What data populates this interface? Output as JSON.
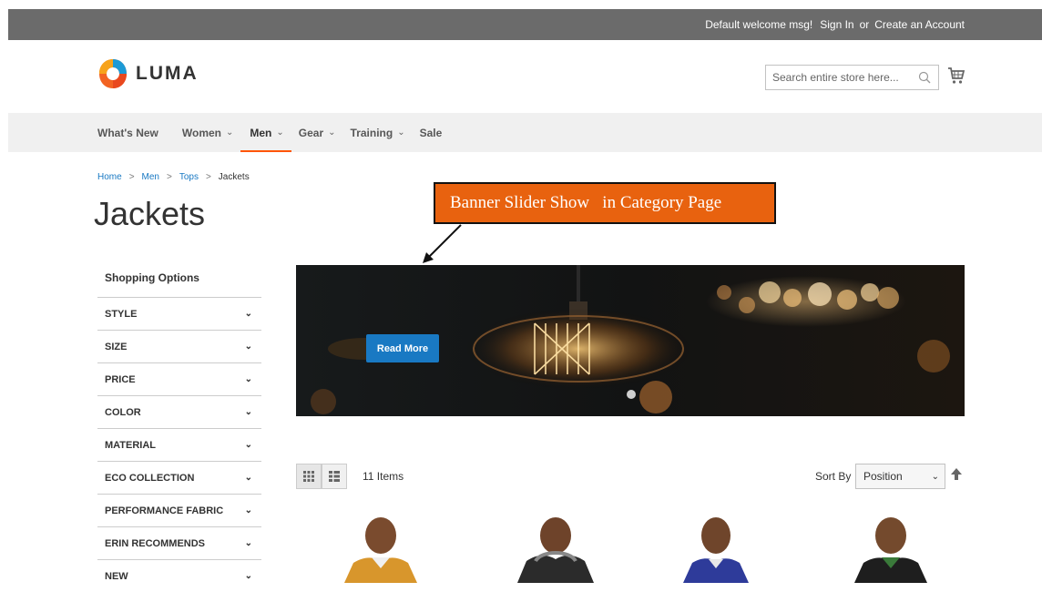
{
  "header": {
    "welcome": "Default welcome msg!",
    "sign_in": "Sign In",
    "or": "or",
    "create_account": "Create an Account",
    "logo_text": "LUMA",
    "search_placeholder": "Search entire store here..."
  },
  "nav": {
    "items": [
      {
        "label": "What's New"
      },
      {
        "label": "Women"
      },
      {
        "label": "Men"
      },
      {
        "label": "Gear"
      },
      {
        "label": "Training"
      },
      {
        "label": "Sale"
      }
    ]
  },
  "breadcrumb": [
    "Home",
    "Men",
    "Tops",
    "Jackets"
  ],
  "page_title": "Jackets",
  "callout_text": "Banner Slider Show   in Category Page",
  "sidebar": {
    "title": "Shopping Options",
    "filters": [
      "STYLE",
      "SIZE",
      "PRICE",
      "COLOR",
      "MATERIAL",
      "ECO COLLECTION",
      "PERFORMANCE FABRIC",
      "ERIN RECOMMENDS",
      "NEW"
    ]
  },
  "banner": {
    "button": "Read More"
  },
  "toolbar": {
    "items_count": "11 Items",
    "sort_label": "Sort By",
    "sort_value": "Position"
  },
  "colors": {
    "topbar": "#6b6b6b",
    "accent": "#ff5501",
    "link": "#1979c3",
    "callout": "#e8620f"
  }
}
